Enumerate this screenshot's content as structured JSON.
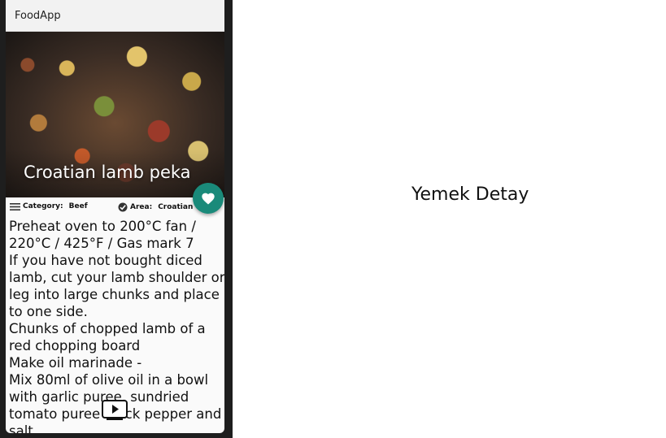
{
  "app": {
    "title": "FoodApp"
  },
  "meal": {
    "name": "Croatian lamb peka",
    "category_label": "Category:",
    "category": "Beef",
    "area_label": "Area:",
    "area": "Croatian",
    "instructions": "Preheat oven to 200°C fan / 220°C / 425°F / Gas mark 7\nIf you have not bought diced lamb, cut your lamb shoulder or leg into large chunks and place to one side.\nChunks of chopped lamb of a red chopping board\nMake oil marinade -\nMix 80ml of olive oil in a bowl with garlic puree, sundried tomato puree black pepper and salt."
  },
  "icons": {
    "favorite": "heart-icon",
    "category": "menu-lines-icon",
    "area": "check-badge-icon",
    "video": "youtube-play-icon"
  },
  "colors": {
    "fab": "#1a8a7a",
    "appbar": "#f2f2f2"
  },
  "caption": "Yemek Detay"
}
